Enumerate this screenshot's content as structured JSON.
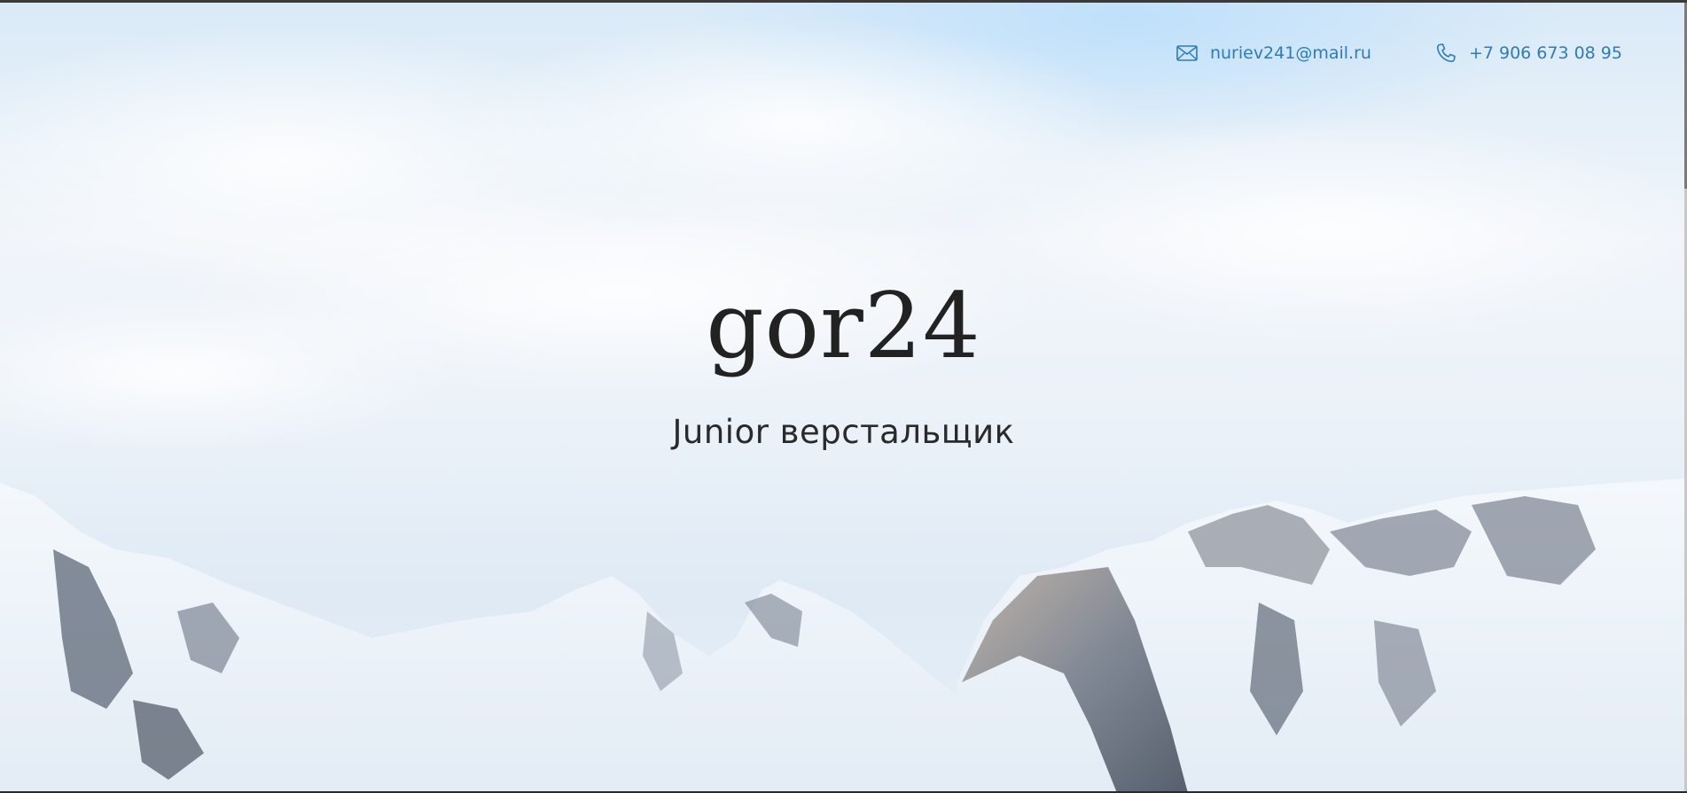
{
  "header": {
    "email": {
      "icon": "envelope-icon",
      "text": "nuriev241@mail.ru"
    },
    "phone": {
      "icon": "phone-icon",
      "text": "+7 906 673 08 95"
    }
  },
  "hero": {
    "logo": "gor24",
    "subtitle": "Junior верстальщик",
    "background": "snowy-mountains-photo"
  },
  "colors": {
    "accent": "#2f7bb6",
    "text": "#222222",
    "sky": "#e6f0f8"
  }
}
